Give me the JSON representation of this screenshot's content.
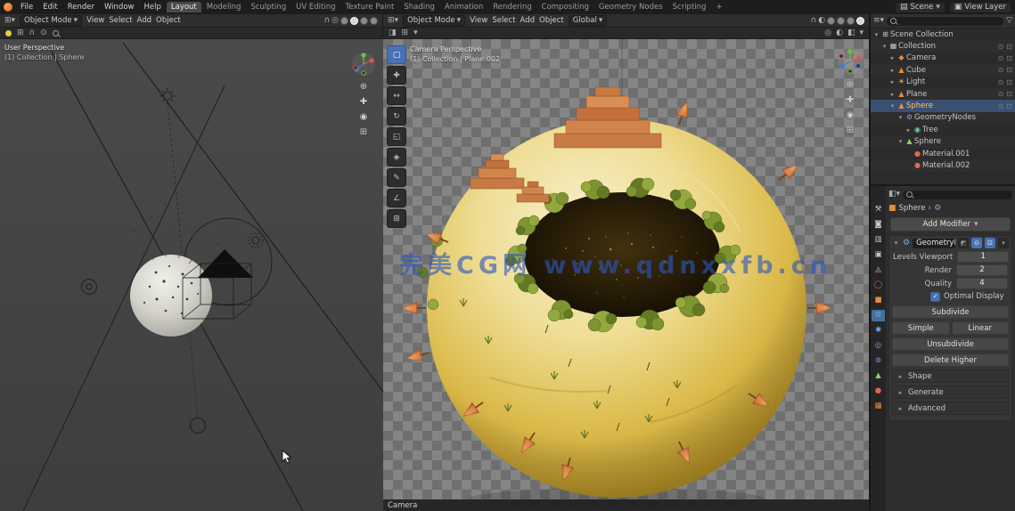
{
  "topbar": {
    "menus": [
      "File",
      "Edit",
      "Render",
      "Window",
      "Help"
    ],
    "workspaces": [
      "Layout",
      "Modeling",
      "Sculpting",
      "UV Editing",
      "Texture Paint",
      "Shading",
      "Animation",
      "Rendering",
      "Compositing",
      "Geometry Nodes",
      "Scripting"
    ],
    "active_workspace": "Layout",
    "add_workspace": "+",
    "scene_label": "Scene",
    "view_layer_label": "View Layer"
  },
  "header": {
    "mode": "Object Mode",
    "menu_view": "View",
    "menu_select": "Select",
    "menu_add": "Add",
    "menu_object": "Object",
    "orientation": "Global"
  },
  "left_viewport": {
    "overlay_title": "User Perspective",
    "overlay_subtitle": "(1) Collection | Sphere"
  },
  "center_viewport": {
    "overlay_title": "Camera Perspective",
    "overlay_subtitle": "(1) Collection | Plane.002",
    "bottom_label": "Camera",
    "watermark": "完美CG网 www.qdnxxfb.cn",
    "tools": [
      "select-box",
      "cursor",
      "move",
      "rotate",
      "scale",
      "transform",
      "annotate",
      "measure",
      "add-primitive"
    ]
  },
  "outliner": {
    "rows": [
      {
        "caret": "▾",
        "icon": "⊞",
        "label": "Scene Collection"
      },
      {
        "caret": "▾",
        "icon": "▦",
        "label": "Collection"
      },
      {
        "caret": "▸",
        "icon": "◆",
        "label": "Camera"
      },
      {
        "caret": "▸",
        "icon": "▲",
        "label": "Cube"
      },
      {
        "caret": "▸",
        "icon": "☀",
        "label": "Light"
      },
      {
        "caret": "▸",
        "icon": "▲",
        "label": "Plane"
      },
      {
        "caret": "▾",
        "icon": "▲",
        "label": "Sphere"
      },
      {
        "caret": "▾",
        "icon": "⚙",
        "label": "GeometryNodes"
      },
      {
        "caret": "▸",
        "icon": "◉",
        "label": "Tree"
      },
      {
        "caret": "▾",
        "icon": "▲",
        "label": "Sphere"
      },
      {
        "caret": "",
        "icon": "●",
        "label": "Material.001"
      },
      {
        "caret": "",
        "icon": "●",
        "label": "Material.002"
      }
    ]
  },
  "properties": {
    "breadcrumb_object": "Sphere",
    "add_modifier_label": "Add Modifier",
    "tabs": [
      {
        "name": "tool",
        "glyph": "⚒"
      },
      {
        "name": "render",
        "glyph": "◙"
      },
      {
        "name": "output",
        "glyph": "▥"
      },
      {
        "name": "view-layer",
        "glyph": "▣"
      },
      {
        "name": "scene",
        "glyph": "◬"
      },
      {
        "name": "world",
        "glyph": "◯"
      },
      {
        "name": "object",
        "glyph": "■"
      },
      {
        "name": "modifiers",
        "glyph": "⚙"
      },
      {
        "name": "particles",
        "glyph": "✱"
      },
      {
        "name": "physics",
        "glyph": "◎"
      },
      {
        "name": "constraints",
        "glyph": "⊚"
      },
      {
        "name": "data",
        "glyph": "▲"
      },
      {
        "name": "material",
        "glyph": "●"
      },
      {
        "name": "texture",
        "glyph": "▦"
      }
    ],
    "modifier": {
      "name": "GeometryNodes",
      "fields": [
        {
          "label": "Levels Viewport",
          "value": "1"
        },
        {
          "label": "Render",
          "value": "2"
        },
        {
          "label": "Quality",
          "value": "4"
        }
      ],
      "checkbox_label": "Optimal Display",
      "checkbox_checked": true,
      "btn_subdivide": "Subdivide",
      "btn_simple": "Simple",
      "btn_linear": "Linear",
      "btn_unsubdivide": "Unsubdivide",
      "btn_delete_higher": "Delete Higher",
      "sections": [
        "Shape",
        "Generate",
        "Advanced"
      ]
    }
  },
  "colors": {
    "accent": "#4772b3",
    "object_orange": "#e78c3c",
    "selection_text": "#ffc27a"
  }
}
